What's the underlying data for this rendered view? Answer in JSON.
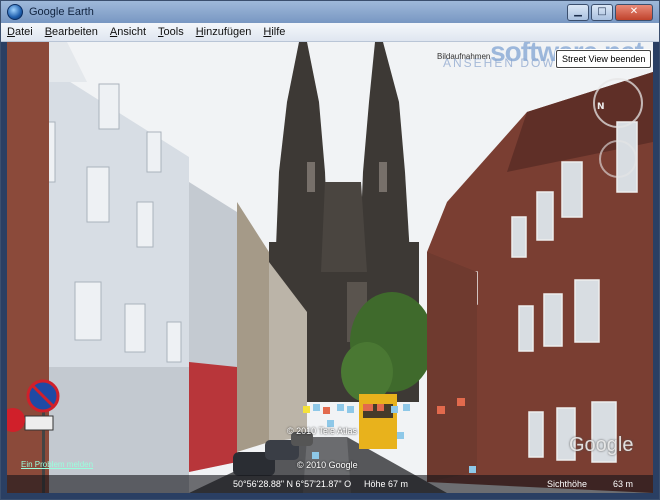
{
  "window": {
    "title": "Google Earth",
    "controls": {
      "minimize": "▁",
      "maximize": "□",
      "close": "✕"
    }
  },
  "menu": {
    "items": [
      {
        "acc": "D",
        "rest": "atei"
      },
      {
        "acc": "B",
        "rest": "earbeiten"
      },
      {
        "acc": "A",
        "rest": "nsicht"
      },
      {
        "acc": "T",
        "rest": "ools"
      },
      {
        "acc": "H",
        "rest": "inzufügen"
      },
      {
        "acc": "H",
        "rest": "ilfe"
      }
    ]
  },
  "watermark": {
    "text": "software.net",
    "sub": "ANSEHEN DOWNLOADS"
  },
  "streetview": {
    "exit_button": "Street View beenden",
    "label": "Bildaufnahmen"
  },
  "overlay": {
    "copyright_1": "© 2010 Tele Atlas",
    "copyright_2": "© 2010 Google",
    "google_logo": "Google",
    "report_link": "Ein Problem melden"
  },
  "status": {
    "coordinates": "50°56'28.88\" N   6°57'21.87\" O",
    "elevation": "Höhe   67 m",
    "eye_alt_label": "Sichthöhe",
    "eye_alt_value": "63 m"
  },
  "colors": {
    "sky": "#f4f6f8",
    "brick": "#7a3e32",
    "cathedral": "#3b3733",
    "tree": "#3f6a2c",
    "bus": "#e8b21c"
  }
}
